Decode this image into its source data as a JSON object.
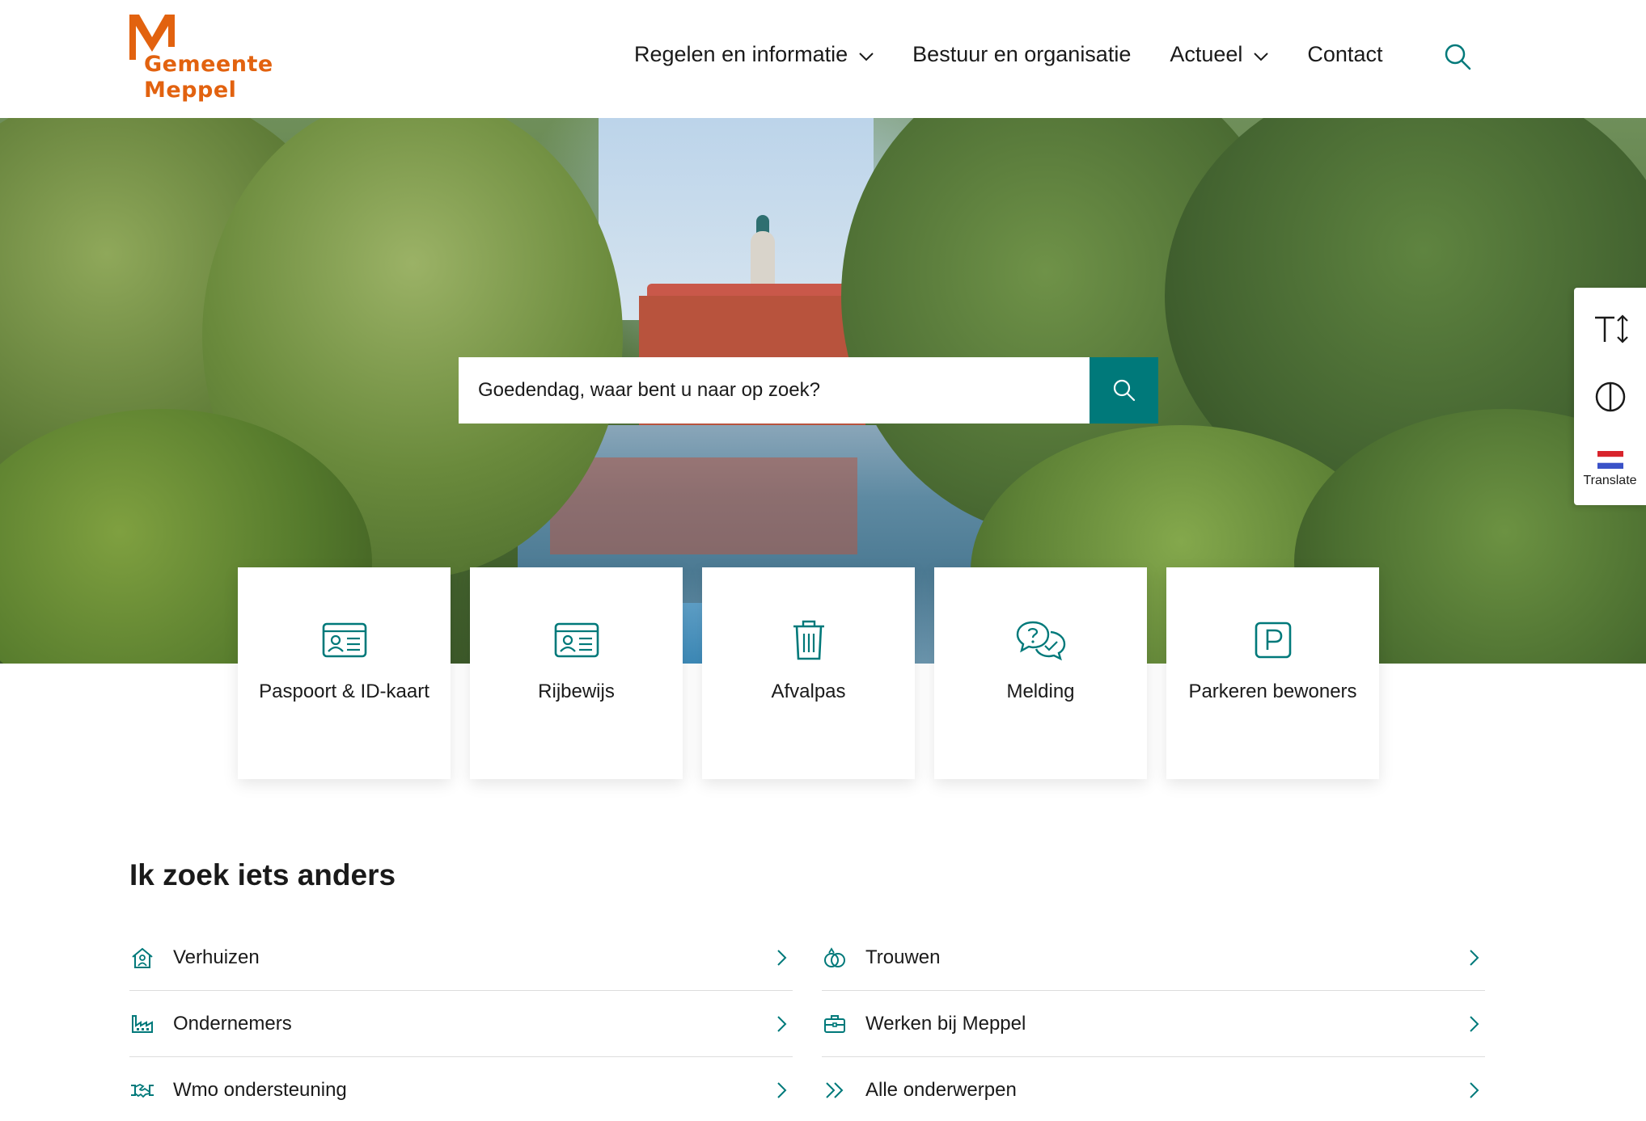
{
  "brand": {
    "name_line1": "Gemeente",
    "name_line2": "Meppel",
    "color": "#e2620f"
  },
  "accent_color": "#00797a",
  "nav": {
    "items": [
      {
        "label": "Regelen en informatie",
        "has_dropdown": true
      },
      {
        "label": "Bestuur en organisatie",
        "has_dropdown": false
      },
      {
        "label": "Actueel",
        "has_dropdown": true
      },
      {
        "label": "Contact",
        "has_dropdown": false
      }
    ],
    "search_icon": "search-icon"
  },
  "search": {
    "placeholder": "Goedendag, waar bent u naar op zoek?",
    "button_icon": "search-icon"
  },
  "accessibility": {
    "text_size_icon": "text-size-icon",
    "contrast_icon": "contrast-icon",
    "translate_label": "Translate",
    "translate_icon": "dutch-flag-icon"
  },
  "tiles": [
    {
      "label": "Paspoort & ID-kaart",
      "icon": "id-card-icon"
    },
    {
      "label": "Rijbewijs",
      "icon": "id-card-icon"
    },
    {
      "label": "Afvalpas",
      "icon": "trash-bin-icon"
    },
    {
      "label": "Melding",
      "icon": "chat-question-icon"
    },
    {
      "label": "Parkeren bewoners",
      "icon": "parking-icon"
    }
  ],
  "section": {
    "title": "Ik zoek iets anders",
    "links_left": [
      {
        "label": "Verhuizen",
        "icon": "house-person-icon"
      },
      {
        "label": "Ondernemers",
        "icon": "factory-icon"
      },
      {
        "label": "Wmo ondersteuning",
        "icon": "handshake-icon"
      }
    ],
    "links_right": [
      {
        "label": "Trouwen",
        "icon": "rings-icon"
      },
      {
        "label": "Werken bij Meppel",
        "icon": "briefcase-icon"
      },
      {
        "label": "Alle onderwerpen",
        "icon": "double-chevron-icon"
      }
    ]
  }
}
